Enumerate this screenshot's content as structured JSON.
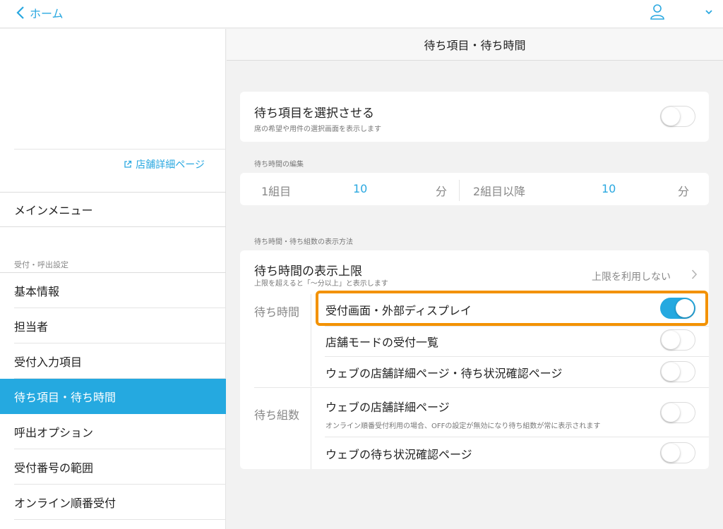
{
  "topbar": {
    "back_label": "ホーム"
  },
  "sidebar": {
    "store_link": "店舗詳細ページ",
    "main_menu": "メインメニュー",
    "section_label": "受付・呼出設定",
    "items": [
      {
        "label": "基本情報"
      },
      {
        "label": "担当者"
      },
      {
        "label": "受付入力項目"
      },
      {
        "label": "待ち項目・待ち時間"
      },
      {
        "label": "呼出オプション"
      },
      {
        "label": "受付番号の範囲"
      },
      {
        "label": "オンライン順番受付"
      }
    ]
  },
  "main": {
    "title": "待ち項目・待ち時間",
    "select_card": {
      "title": "待ち項目を選択させる",
      "subtitle": "席の希望や用件の選択画面を表示します",
      "toggle_on": false
    },
    "wait_edit": {
      "label": "待ち時間の編集",
      "group1_label": "1組目",
      "group1_value": "10",
      "group1_unit": "分",
      "group2_label": "2組目以降",
      "group2_value": "10",
      "group2_unit": "分"
    },
    "display": {
      "label": "待ち時間・待ち組数の表示方法",
      "upper_limit_title": "待ち時間の表示上限",
      "upper_limit_sub": "上限を超えると「〜分以上」と表示します",
      "upper_limit_value": "上限を利用しない",
      "wait_time_label": "待ち時間",
      "wait_time_rows": [
        {
          "label": "受付画面・外部ディスプレイ",
          "on": true
        },
        {
          "label": "店舗モードの受付一覧",
          "on": false
        },
        {
          "label": "ウェブの店舗詳細ページ・待ち状況確認ページ",
          "on": false
        }
      ],
      "wait_groups_label": "待ち組数",
      "wait_group_rows": [
        {
          "label": "ウェブの店舗詳細ページ",
          "sub": "オンライン順番受付利用の場合、OFFの設定が無効になり待ち組数が常に表示されます",
          "on": false
        },
        {
          "label": "ウェブの待ち状況確認ページ",
          "on": false
        }
      ]
    }
  },
  "colors": {
    "accent": "#25a9e0",
    "highlight": "#f39200"
  }
}
